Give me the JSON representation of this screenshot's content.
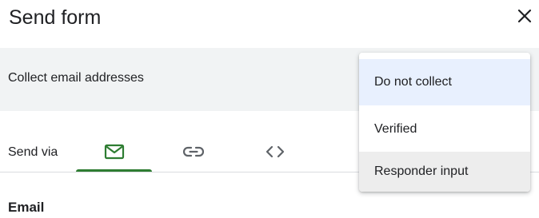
{
  "dialog": {
    "title": "Send form",
    "close_icon": "close-icon"
  },
  "collect_email": {
    "label": "Collect email addresses",
    "options": [
      "Do not collect",
      "Verified",
      "Responder input"
    ],
    "highlighted": "Do not collect",
    "hovered": "Responder input"
  },
  "send_via": {
    "label": "Send via",
    "tabs": [
      {
        "icon": "mail-icon",
        "active": true
      },
      {
        "icon": "link-icon",
        "active": false
      },
      {
        "icon": "embed-code-icon",
        "active": false
      }
    ]
  },
  "email_section": {
    "heading": "Email"
  },
  "colors": {
    "accent_green": "#2e7d32",
    "row_gray": "#f1f3f4",
    "selected_option": "#e8f0fe",
    "hover_option": "#ededed",
    "icon_gray": "#5f6368"
  }
}
